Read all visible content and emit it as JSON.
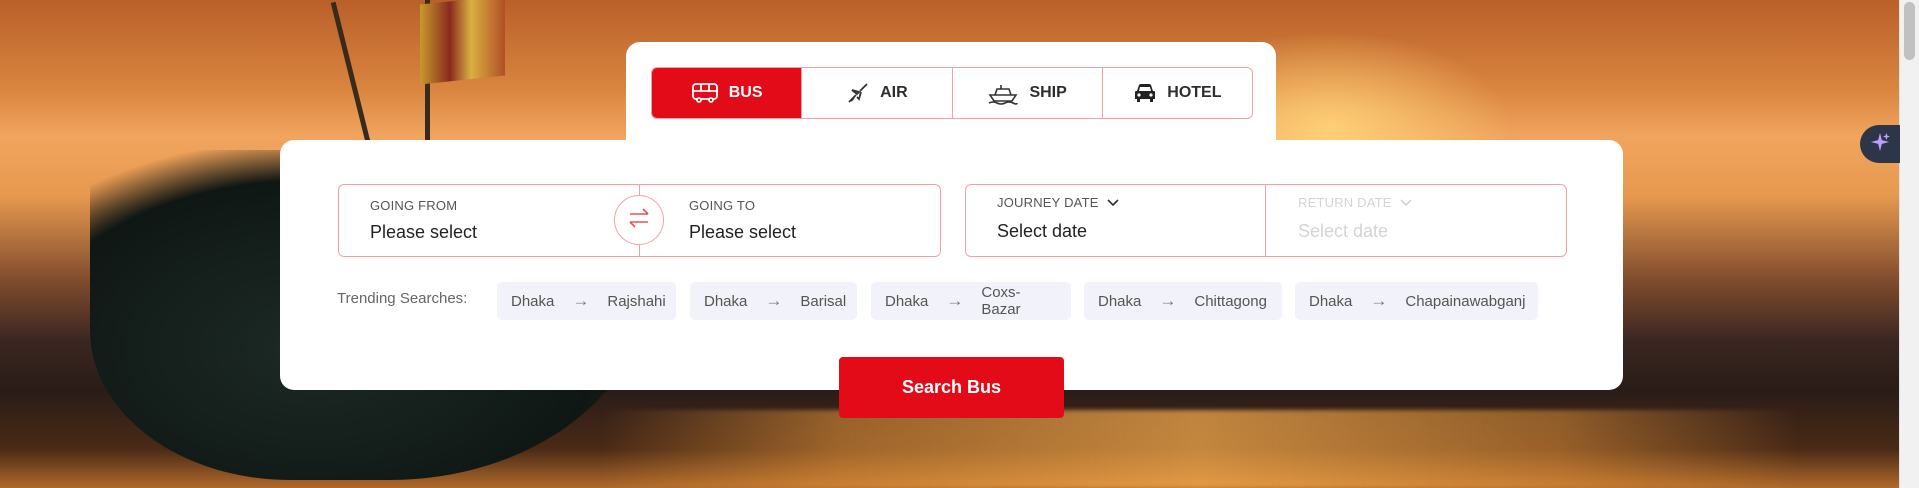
{
  "tabs": [
    {
      "label": "BUS",
      "icon": "bus-icon"
    },
    {
      "label": "AIR",
      "icon": "airplane-icon"
    },
    {
      "label": "SHIP",
      "icon": "ship-icon"
    },
    {
      "label": "HOTEL",
      "icon": "car-icon"
    }
  ],
  "active_tab": "BUS",
  "route": {
    "from": {
      "label": "GOING FROM",
      "value": "Please select"
    },
    "to": {
      "label": "GOING TO",
      "value": "Please select"
    }
  },
  "dates": {
    "journey": {
      "label": "JOURNEY DATE",
      "value": "Select date"
    },
    "return": {
      "label": "RETURN DATE",
      "value": "Select date"
    }
  },
  "trending": {
    "label": "Trending Searches:",
    "items": [
      {
        "from": "Dhaka",
        "to": "Rajshahi"
      },
      {
        "from": "Dhaka",
        "to": "Barisal"
      },
      {
        "from": "Dhaka",
        "to": "Coxs-Bazar"
      },
      {
        "from": "Dhaka",
        "to": "Chittagong"
      },
      {
        "from": "Dhaka",
        "to": "Chapainawabganj"
      }
    ]
  },
  "search_button": "Search Bus",
  "colors": {
    "accent": "#e30b17",
    "border": "#f3a0a8",
    "chip_bg": "#f2f2fa"
  }
}
